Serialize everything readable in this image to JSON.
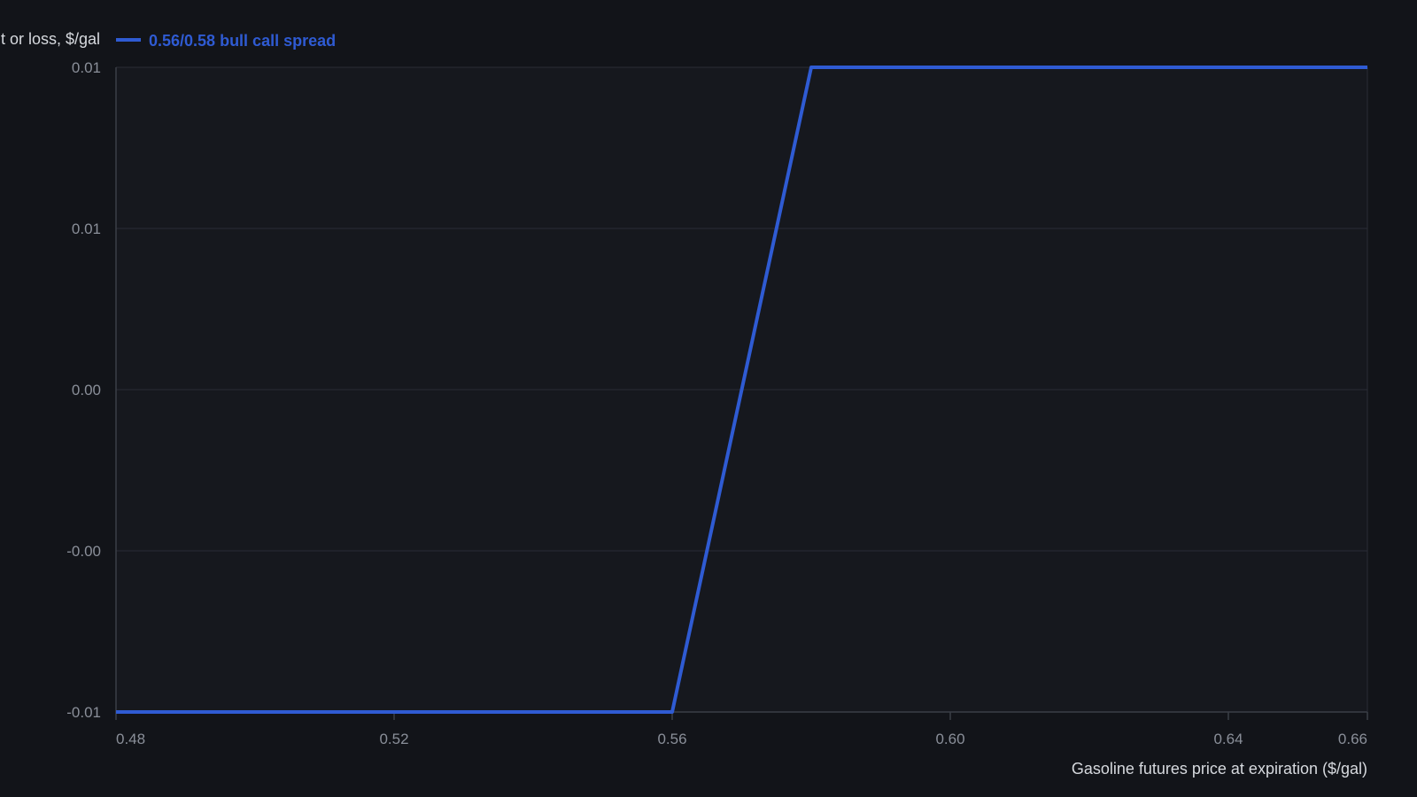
{
  "chart_data": {
    "type": "line",
    "title": "",
    "ylabel": "Profit or loss, $/gal",
    "xlabel": "Gasoline futures price at expiration ($/gal)",
    "xlim": [
      0.48,
      0.66
    ],
    "ylim": [
      -0.01,
      0.01
    ],
    "x_ticks": [
      0.48,
      0.52,
      0.56,
      0.6,
      0.64,
      0.66
    ],
    "x_tick_labels": [
      "0.48",
      "0.52",
      "0.56",
      "0.60",
      "0.64",
      "0.66"
    ],
    "y_ticks": [
      -0.01,
      -0.005,
      0.0,
      0.005,
      0.01
    ],
    "y_tick_labels": [
      "-0.01",
      "-0.00",
      "0.00",
      "0.01",
      "0.01"
    ],
    "grid": true,
    "legend_position": "top-left",
    "series": [
      {
        "name": "0.56/0.58 bull call spread",
        "color": "#2f5bd3",
        "x": [
          0.48,
          0.56,
          0.58,
          0.66
        ],
        "y": [
          -0.01,
          -0.01,
          0.01,
          0.01
        ]
      }
    ]
  },
  "colors": {
    "background": "#121419",
    "plot_background": "#16181e",
    "grid": "#2a2d35",
    "axis": "#3a3e47",
    "tick_text": "#8a8f99",
    "title_text": "#d6d9de"
  }
}
